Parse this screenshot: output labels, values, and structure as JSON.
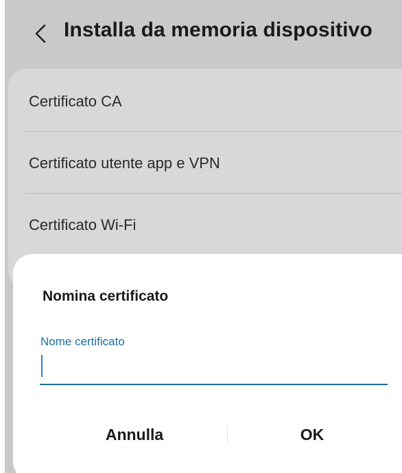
{
  "header": {
    "title": "Installa da memoria dispositivo",
    "back_icon": "chevron-left-icon"
  },
  "list": {
    "items": [
      {
        "label": "Certificato CA"
      },
      {
        "label": "Certificato utente app e VPN"
      },
      {
        "label": "Certificato Wi-Fi"
      }
    ]
  },
  "dialog": {
    "title": "Nomina certificato",
    "field": {
      "label": "Nome certificato",
      "value": ""
    },
    "buttons": {
      "cancel_label": "Annulla",
      "ok_label": "OK"
    }
  },
  "colors": {
    "accent": "#1a6fa0",
    "underline": "#1c6b94",
    "scrim": "#c9c9c9"
  }
}
